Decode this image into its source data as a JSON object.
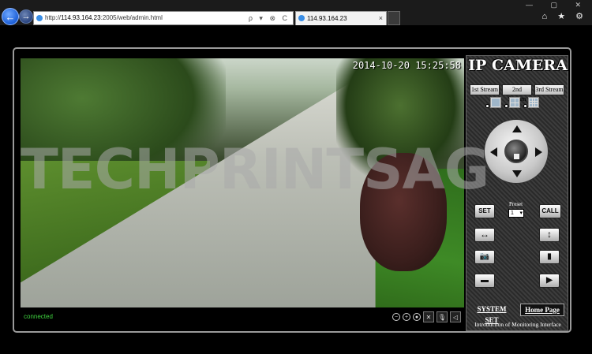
{
  "browser": {
    "address": {
      "protocol": "http://",
      "host": "114.93.164.23",
      "path": ":2005/web/admin.html",
      "tools": "ρ ▾ ⊗ C"
    },
    "tab": {
      "title": "114.93.164.23",
      "close": "×"
    },
    "back_icon": "←",
    "forward_icon": "→",
    "window_controls": "— ▢ ✕",
    "right_tools": "⌂ ★ ⚙"
  },
  "video": {
    "timestamp": "2014-10-20 15:25:58",
    "watermark": "TECHPRINTSAG"
  },
  "status": {
    "text": "connected",
    "icons": [
      "zoom-out-icon",
      "zoom-in-icon",
      "record-icon",
      "tools-icon",
      "mic-mute-icon",
      "speaker-icon"
    ]
  },
  "panel": {
    "title": "IP CAMERA",
    "streams": [
      "1st Stream",
      "2nd Stream",
      "3rd Stream"
    ],
    "set_label": "SET",
    "call_label": "CALL",
    "preset_label": "Preset",
    "preset_value": "1",
    "system_set": "SYSTEM SET",
    "home_page": "Home Page",
    "intro": "Introduction of Monitoring Interface"
  },
  "colors": {
    "status_text": "#3fd23f",
    "back_button": "#1d5fd6"
  }
}
